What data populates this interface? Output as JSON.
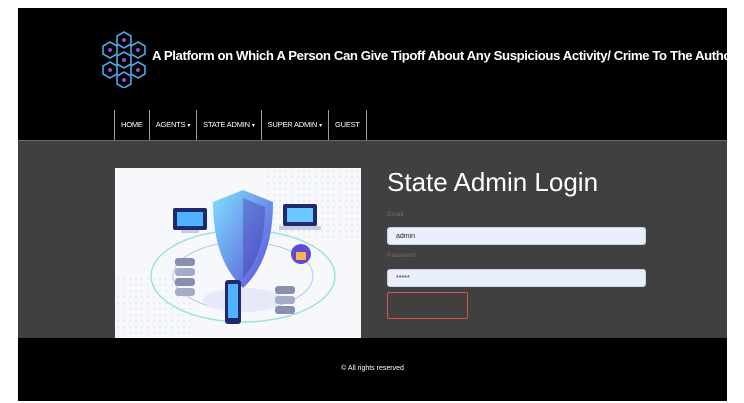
{
  "header": {
    "site_title": "A Platform on Which A Person Can Give Tipoff About Any Suspicious Activity/ Crime To The Authorities"
  },
  "nav": {
    "items": [
      {
        "label": "HOME",
        "dropdown": false
      },
      {
        "label": "AGENTS",
        "dropdown": true
      },
      {
        "label": "STATE ADMIN",
        "dropdown": true
      },
      {
        "label": "SUPER ADMIN",
        "dropdown": true
      },
      {
        "label": "GUEST",
        "dropdown": false
      }
    ],
    "caret": "▾"
  },
  "login": {
    "title": "State Admin Login",
    "email_label": "Email",
    "email_value": "admin",
    "password_label": "Password",
    "password_value": "*****",
    "submit_label": ""
  },
  "footer": {
    "copyright": "© All rights reserved"
  },
  "colors": {
    "header_bg": "#000000",
    "main_bg": "#404040",
    "input_bg": "#e9f0fc",
    "button_border": "#d9534f",
    "illustration_accent": "#5b4bd6",
    "logo_primary": "#4aa8e8"
  },
  "icons": [
    "network-cubes-logo",
    "security-shield-illustration"
  ]
}
